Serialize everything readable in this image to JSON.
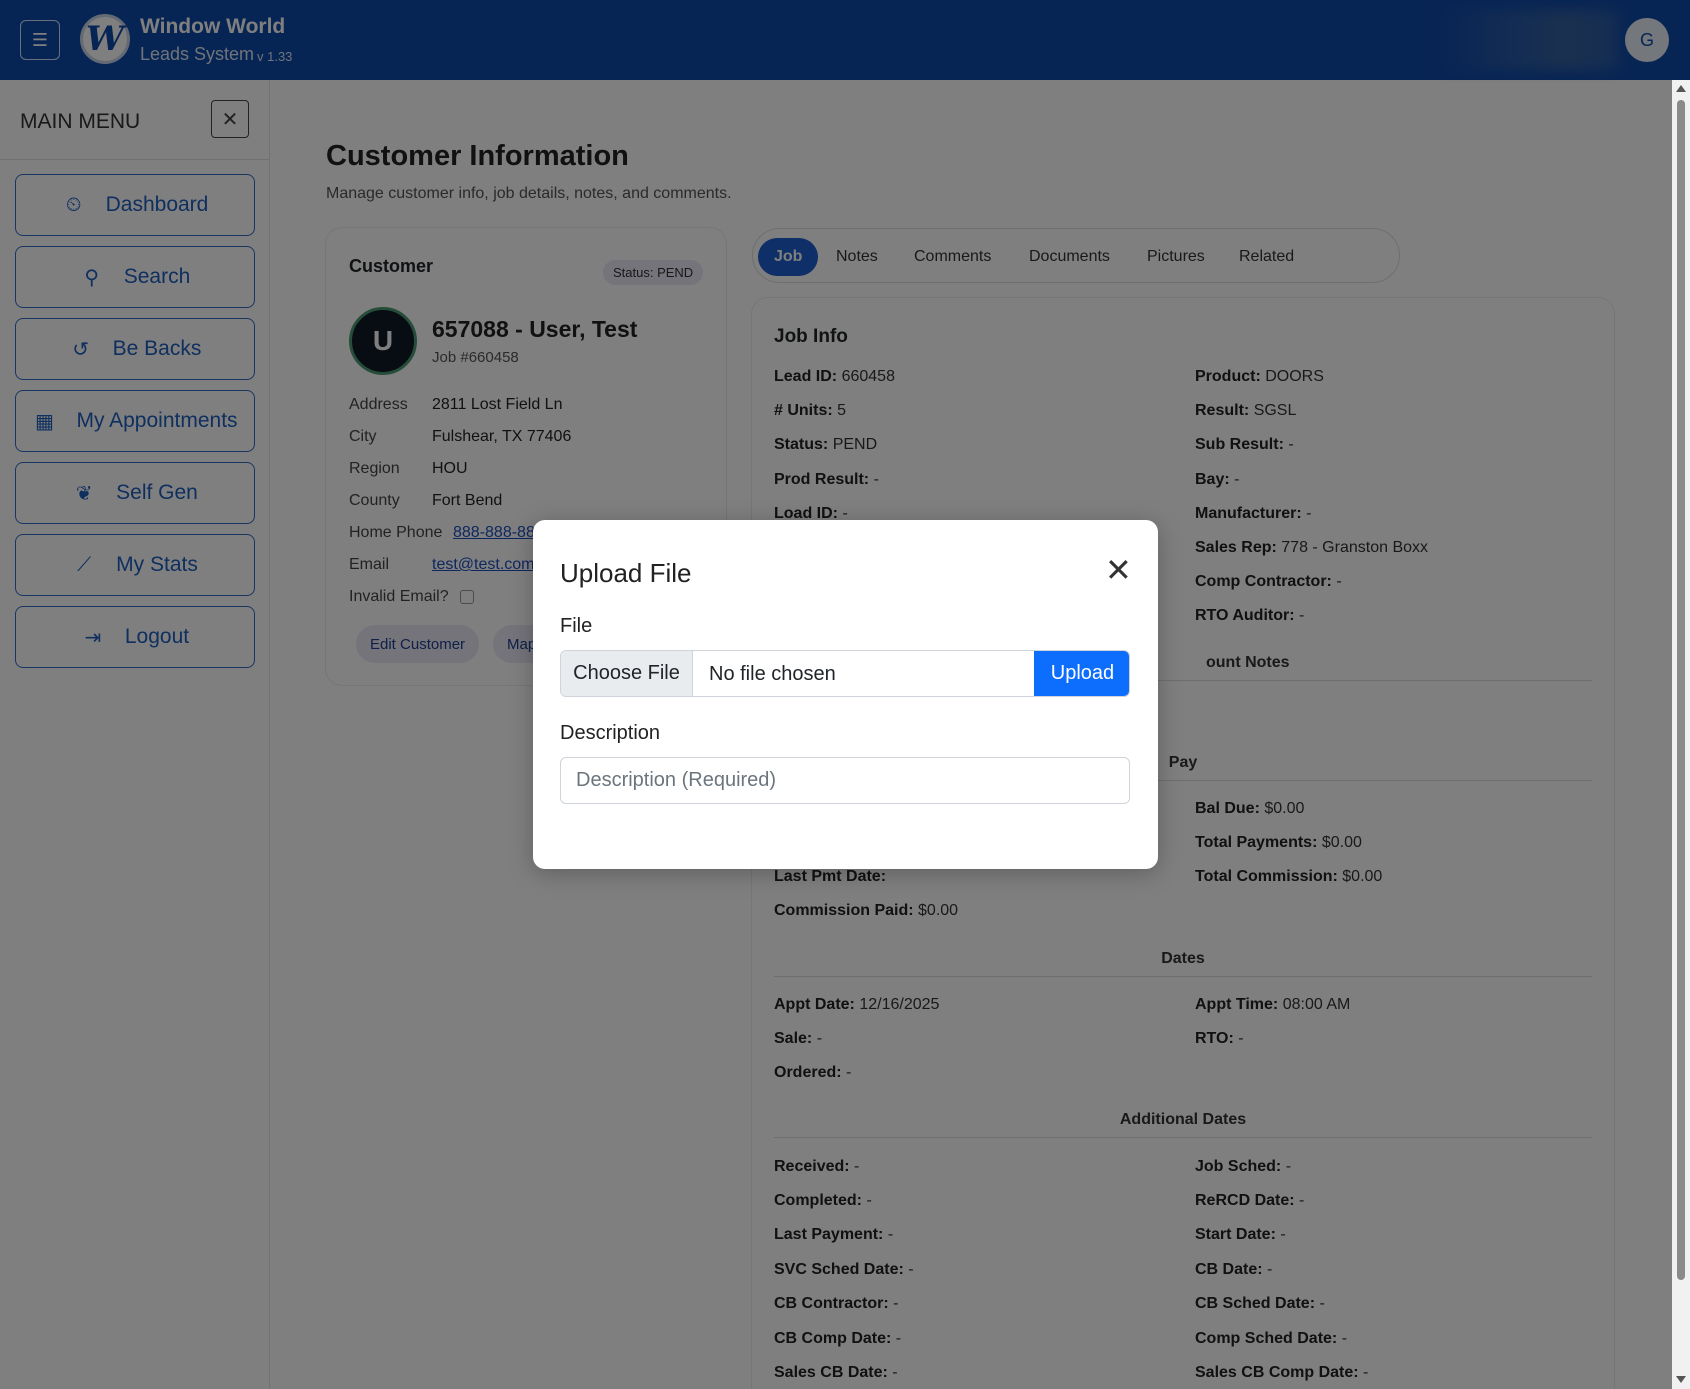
{
  "topbar": {
    "menu_icon": "☰",
    "logo_letter": "W",
    "brand_title": "Window World",
    "brand_sub": "Leads System",
    "version": "v 1.33",
    "user_initial": "G"
  },
  "sidebar": {
    "title": "MAIN MENU",
    "close_icon": "✕",
    "items": [
      {
        "label": "Dashboard",
        "icon": "⏲"
      },
      {
        "label": "Search",
        "icon": "⚲"
      },
      {
        "label": "Be Backs",
        "icon": "↺"
      },
      {
        "label": "My Appointments",
        "icon": "▦"
      },
      {
        "label": "Self Gen",
        "icon": "❦"
      },
      {
        "label": "My Stats",
        "icon": "⟋"
      },
      {
        "label": "Logout",
        "icon": "⇥"
      }
    ]
  },
  "page": {
    "title": "Customer Information",
    "subtitle": "Manage customer info, job details, notes, and comments."
  },
  "customer": {
    "card_title": "Customer",
    "status": "Status: PEND",
    "avatar_initial": "U",
    "name": "657088 - User, Test",
    "job": "Job #660458",
    "fields": {
      "address_label": "Address",
      "address": "2811 Lost Field Ln",
      "city_label": "City",
      "city": "Fulshear, TX 77406",
      "region_label": "Region",
      "region": "HOU",
      "county_label": "County",
      "county": "Fort Bend",
      "phone_label": "Home Phone",
      "phone": "888-888-88",
      "email_label": "Email",
      "email": "test@test.com",
      "invalid_email_label": "Invalid Email?"
    },
    "edit_button": "Edit Customer",
    "map_button": "Map"
  },
  "tabs": [
    "Job",
    "Notes",
    "Comments",
    "Documents",
    "Pictures",
    "Related"
  ],
  "job_info": {
    "title": "Job Info",
    "left": [
      {
        "k": "Lead ID:",
        "v": "660458"
      },
      {
        "k": "# Units:",
        "v": "5"
      },
      {
        "k": "Status:",
        "v": "PEND"
      },
      {
        "k": "Prod Result:",
        "v": "-"
      },
      {
        "k": "Load ID:",
        "v": "-"
      }
    ],
    "right": [
      {
        "k": "Product:",
        "v": "DOORS"
      },
      {
        "k": "Result:",
        "v": "SGSL"
      },
      {
        "k": "Sub Result:",
        "v": "-"
      },
      {
        "k": "Bay:",
        "v": "-"
      },
      {
        "k": "Manufacturer:",
        "v": "-"
      },
      {
        "k": "Sales Rep:",
        "v": "778 - Granston Boxx"
      },
      {
        "k": "Comp Contractor:",
        "v": "-"
      },
      {
        "k": "RTO Auditor:",
        "v": "-"
      }
    ],
    "account_notes_header": "ount Notes",
    "pay_header": "Pay",
    "pay_left": [
      {
        "k": "Last Pmt Date:",
        "v": ""
      },
      {
        "k": "Commission Paid:",
        "v": "$0.00"
      }
    ],
    "pay_right": [
      {
        "k": "Bal Due:",
        "v": "$0.00"
      },
      {
        "k": "Total Payments:",
        "v": "$0.00"
      },
      {
        "k": "Total Commission:",
        "v": "$0.00"
      }
    ],
    "dates_header": "Dates",
    "dates_left": [
      {
        "k": "Appt Date:",
        "v": "12/16/2025"
      },
      {
        "k": "Sale:",
        "v": "-"
      },
      {
        "k": "Ordered:",
        "v": "-"
      }
    ],
    "dates_right": [
      {
        "k": "Appt Time:",
        "v": "08:00 AM"
      },
      {
        "k": "RTO:",
        "v": "-"
      }
    ],
    "add_dates_header": "Additional Dates",
    "add_left": [
      {
        "k": "Received:",
        "v": "-"
      },
      {
        "k": "Completed:",
        "v": "-"
      },
      {
        "k": "Last Payment:",
        "v": "-"
      },
      {
        "k": "SVC Sched Date:",
        "v": "-"
      },
      {
        "k": "CB Contractor:",
        "v": "-"
      },
      {
        "k": "CB Comp Date:",
        "v": "-"
      },
      {
        "k": "Sales CB Date:",
        "v": "-"
      }
    ],
    "add_right": [
      {
        "k": "Job Sched:",
        "v": "-"
      },
      {
        "k": "ReRCD Date:",
        "v": "-"
      },
      {
        "k": "Start Date:",
        "v": "-"
      },
      {
        "k": "CB Date:",
        "v": "-"
      },
      {
        "k": "CB Sched Date:",
        "v": "-"
      },
      {
        "k": "Comp Sched Date:",
        "v": "-"
      },
      {
        "k": "Sales CB Comp Date:",
        "v": "-"
      }
    ]
  },
  "modal": {
    "title": "Upload File",
    "close_icon": "✕",
    "file_label": "File",
    "choose_button": "Choose File",
    "file_status": "No file chosen",
    "upload_button": "Upload",
    "description_label": "Description",
    "description_placeholder": "Description (Required)",
    "description_value": ""
  }
}
